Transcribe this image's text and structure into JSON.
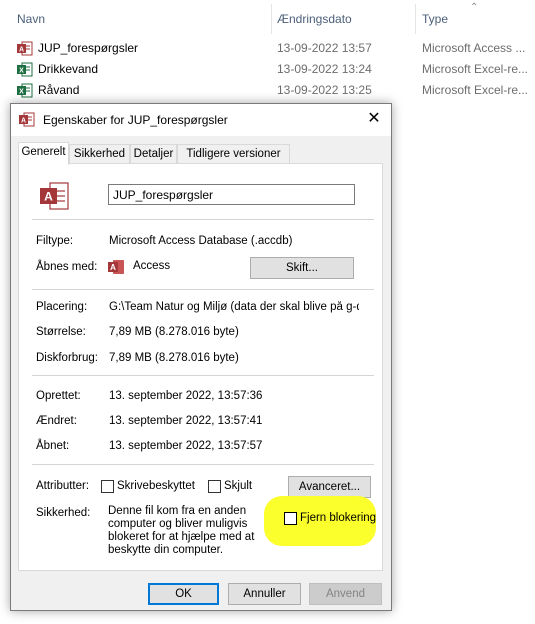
{
  "explorer": {
    "columns": {
      "name": "Navn",
      "date": "Ændringsdato",
      "type": "Type"
    },
    "files": [
      {
        "name": "JUP_forespørgsler",
        "date": "13-09-2022 13:57",
        "type": "Microsoft Access ...",
        "icon": "access-file-icon"
      },
      {
        "name": "Drikkevand",
        "date": "13-09-2022 13:24",
        "type": "Microsoft Excel-re...",
        "icon": "excel-file-icon"
      },
      {
        "name": "Råvand",
        "date": "13-09-2022 13:25",
        "type": "Microsoft Excel-re...",
        "icon": "excel-file-icon"
      }
    ]
  },
  "dialog": {
    "title": "Egenskaber for JUP_forespørgsler",
    "tabs": [
      "Generelt",
      "Sikkerhed",
      "Detaljer",
      "Tidligere versioner"
    ],
    "file_name": "JUP_forespørgsler",
    "filetype_label": "Filtype:",
    "filetype_value": "Microsoft Access Database (.accdb)",
    "opens_with_label": "Åbnes med:",
    "opens_with_value": "Access",
    "change_button": "Skift...",
    "location_label": "Placering:",
    "location_value": "G:\\Team Natur og Miljø (data der skal blive på g-drev",
    "size_label": "Størrelse:",
    "size_value": "7,89 MB (8.278.016 byte)",
    "disk_label": "Diskforbrug:",
    "disk_value": "7,89 MB (8.278.016 byte)",
    "created_label": "Oprettet:",
    "created_value": "13. september 2022, 13:57:36",
    "modified_label": "Ændret:",
    "modified_value": "13. september 2022, 13:57:41",
    "accessed_label": "Åbnet:",
    "accessed_value": "13. september 2022, 13:57:57",
    "attributes_label": "Attributter:",
    "readonly_label": "Skrivebeskyttet",
    "hidden_label": "Skjult",
    "advanced_button": "Avanceret...",
    "security_label": "Sikkerhed:",
    "security_text": "Denne fil kom fra en anden computer og bliver muligvis blokeret for at hjælpe med at beskytte din computer.",
    "unblock_label": "Fjern blokering",
    "ok_button": "OK",
    "cancel_button": "Annuller",
    "apply_button": "Anvend",
    "highlight_color": "#fbff2b",
    "access_color": "#a4373a",
    "excel_color": "#1d6f42"
  }
}
